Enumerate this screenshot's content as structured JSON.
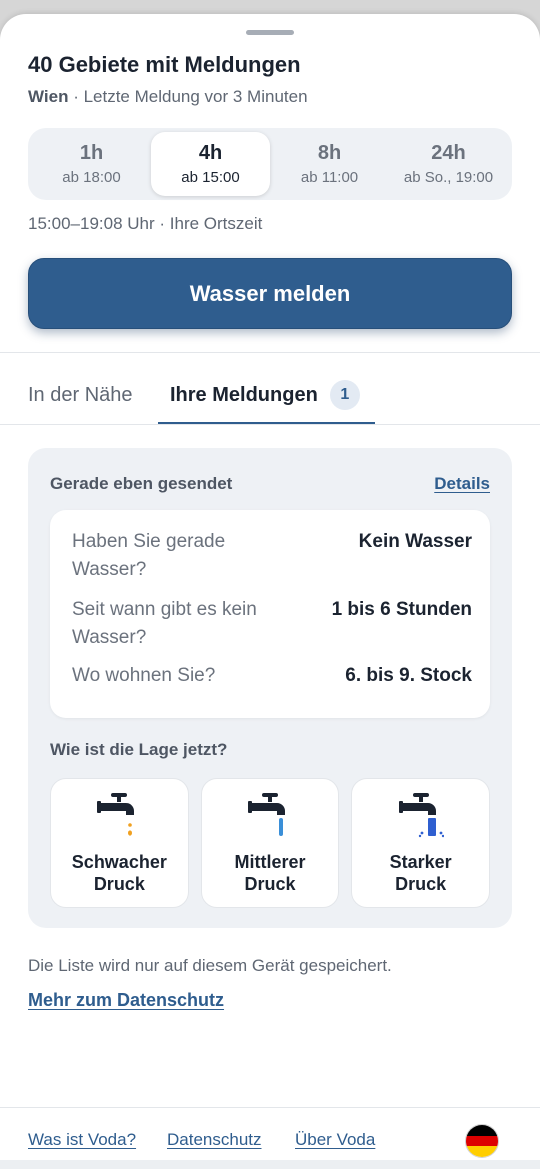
{
  "header": {
    "title": "40 Gebiete mit Meldungen",
    "city": "Wien",
    "subtitle_rest": " · Letzte Meldung vor 3 Minuten"
  },
  "time_ranges": [
    {
      "label": "1h",
      "sub": "ab 18:00",
      "active": false
    },
    {
      "label": "4h",
      "sub": "ab 15:00",
      "active": true
    },
    {
      "label": "8h",
      "sub": "ab 11:00",
      "active": false
    },
    {
      "label": "24h",
      "sub": "ab So., 19:00",
      "active": false
    }
  ],
  "timezone_text": "15:00–19:08 Uhr · Ihre Ortszeit",
  "primary_button": "Wasser melden",
  "tabs": {
    "nearby": "In der Nähe",
    "mine": "Ihre Meldungen",
    "mine_count": "1"
  },
  "report_card": {
    "heading": "Gerade eben gesendet",
    "details_link": "Details",
    "answers": [
      {
        "question": "Haben Sie gerade Wasser?",
        "answer": "Kein Wasser"
      },
      {
        "question": "Seit wann gibt es kein Wasser?",
        "answer": "1 bis 6 Stunden"
      },
      {
        "question": "Wo wohnen Sie?",
        "answer": "6. bis 9. Stock"
      }
    ],
    "status_question": "Wie ist die Lage jetzt?",
    "options": [
      {
        "label": "Schwacher Druck",
        "icon": "faucet-drip-icon",
        "water_color": "#f0a020"
      },
      {
        "label": "Mittlerer Druck",
        "icon": "faucet-stream-icon",
        "water_color": "#3a8fd8"
      },
      {
        "label": "Starker Druck",
        "icon": "faucet-splash-icon",
        "water_color": "#2f5fd0"
      }
    ]
  },
  "note": "Die Liste wird nur auf diesem Gerät gespeichert.",
  "privacy_link": "Mehr zum Datenschutz",
  "footer": {
    "links": [
      "Was ist Voda?",
      "Datenschutz",
      "Über Voda"
    ],
    "flag_icon": "germany-flag-icon"
  },
  "colors": {
    "accent": "#2f5d8e",
    "flag": [
      "#000000",
      "#dd0000",
      "#ffce00"
    ]
  }
}
